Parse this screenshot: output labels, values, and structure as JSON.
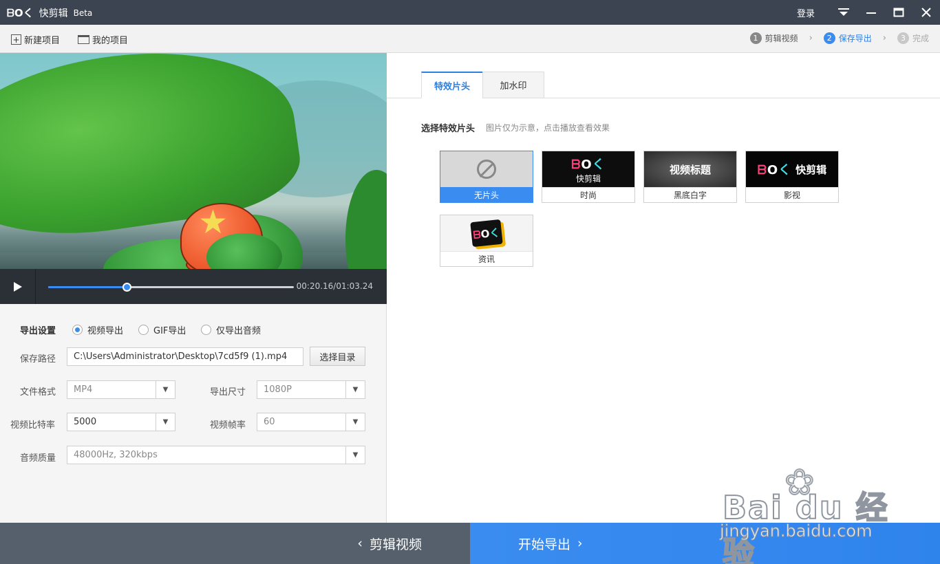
{
  "app": {
    "logo_mark": "ᗷOく",
    "name": "快剪辑",
    "badge": "Beta",
    "login": "登录"
  },
  "toolbar": {
    "new_project": "新建项目",
    "my_projects": "我的项目"
  },
  "steps": [
    {
      "num": "1",
      "label": "剪辑视频",
      "state": "done"
    },
    {
      "num": "2",
      "label": "保存导出",
      "state": "active"
    },
    {
      "num": "3",
      "label": "完成",
      "state": "pending"
    }
  ],
  "player": {
    "timecode": "00:20.16/01:03.24",
    "progress": 0.32
  },
  "export": {
    "section_label": "导出设置",
    "mode_options": [
      "视频导出",
      "GIF导出",
      "仅导出音频"
    ],
    "selected_mode": "视频导出",
    "path_label": "保存路径",
    "path_value": "C:\\Users\\Administrator\\Desktop\\7cd5f9 (1).mp4",
    "choose_dir": "选择目录",
    "format_label": "文件格式",
    "format_value": "MP4",
    "size_label": "导出尺寸",
    "size_value": "1080P",
    "bitrate_label": "视频比特率",
    "bitrate_value": "5000",
    "fps_label": "视频帧率",
    "fps_value": "60",
    "audio_label": "音频质量",
    "audio_value": "48000Hz, 320kbps"
  },
  "right_panel": {
    "tabs": [
      "特效片头",
      "加水印"
    ],
    "active_tab": "特效片头",
    "section_title": "选择特效片头",
    "section_hint": "图片仅为示意，点击播放查看效果",
    "templates": [
      {
        "caption": "无片头",
        "thumb_text": ""
      },
      {
        "caption": "时尚",
        "thumb_text": "快剪辑"
      },
      {
        "caption": "黑底白字",
        "thumb_text": "视频标题"
      },
      {
        "caption": "影视",
        "thumb_text": "快剪辑"
      },
      {
        "caption": "资讯",
        "thumb_text": ""
      }
    ],
    "selected_template": "无片头"
  },
  "bottom": {
    "back_label": "剪辑视频",
    "export_label": "开始导出"
  },
  "watermark": {
    "brand": "Bai du 经验",
    "url": "jingyan.baidu.com"
  },
  "colors": {
    "accent": "#3a8cf0",
    "titlebar": "#3c4451",
    "bottom_left": "#56606d"
  }
}
